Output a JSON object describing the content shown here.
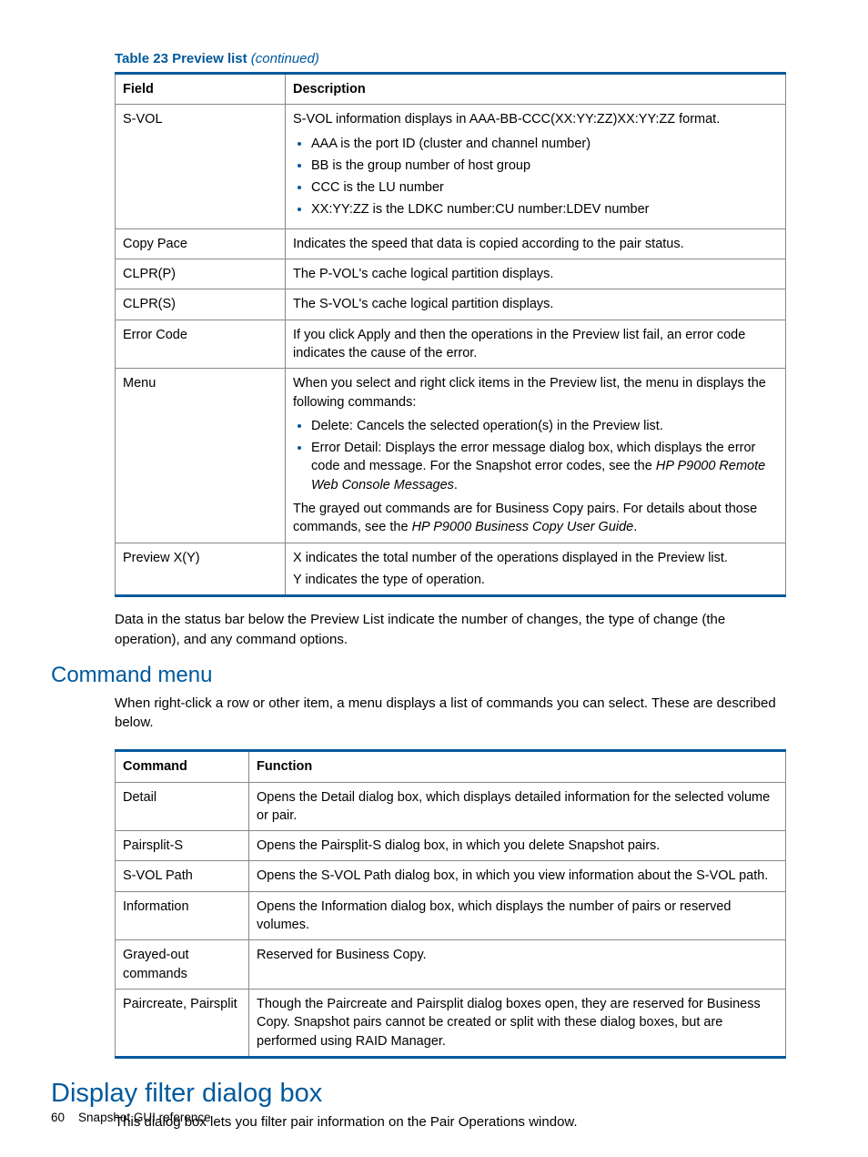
{
  "caption": {
    "label": "Table 23 Preview list",
    "cont": " (continued)"
  },
  "table23": {
    "head": {
      "field": "Field",
      "desc": "Description"
    },
    "rows": [
      {
        "field": "S-VOL",
        "intro": "S-VOL information displays in AAA-BB-CCC(XX:YY:ZZ)XX:YY:ZZ format.",
        "bullets": [
          "AAA is the port ID (cluster and channel number)",
          "BB is the group number of host group",
          "CCC is the LU number",
          "XX:YY:ZZ is the LDKC number:CU number:LDEV number"
        ]
      },
      {
        "field": "Copy Pace",
        "desc": "Indicates the speed that data is copied according to the pair status."
      },
      {
        "field": "CLPR(P)",
        "desc": "The P-VOL's cache logical partition displays."
      },
      {
        "field": "CLPR(S)",
        "desc": "The S-VOL's cache logical partition displays."
      },
      {
        "field": "Error Code",
        "desc": "If you click Apply and then the operations in the Preview list fail, an error code indicates the cause of the error."
      },
      {
        "field": "Menu",
        "intro": "When you select and right click items in the Preview list, the menu in displays the following commands:",
        "bullets": [
          "Delete: Cancels the selected operation(s) in the Preview list."
        ],
        "bullet2_pre": "Error Detail: Displays the error message dialog box, which displays the error code and message. For the Snapshot error codes, see the ",
        "bullet2_ital": "HP P9000 Remote Web Console Messages",
        "bullet2_post": ".",
        "outro_pre": "The grayed out commands are for Business Copy pairs. For details about those commands, see the ",
        "outro_ital": "HP P9000 Business Copy User Guide",
        "outro_post": "."
      },
      {
        "field": "Preview X(Y)",
        "line1": "X indicates the total number of the operations displayed in the Preview list.",
        "line2": "Y indicates the type of operation."
      }
    ]
  },
  "para_after_t23": "Data in the status bar below the Preview List indicate the number of changes, the type of change (the operation), and any command options.",
  "h2_cmd": "Command menu",
  "para_cmd": "When right-click a row or other item, a menu displays a list of commands you can select. These are described below.",
  "tablecmd": {
    "head": {
      "cmd": "Command",
      "func": "Function"
    },
    "rows": [
      {
        "cmd": "Detail",
        "func": "Opens the Detail dialog box, which displays detailed information for the selected volume or pair."
      },
      {
        "cmd": "Pairsplit-S",
        "func": "Opens the Pairsplit-S dialog box, in which you delete Snapshot pairs."
      },
      {
        "cmd": "S-VOL Path",
        "func": "Opens the S-VOL Path dialog box, in which you view information about the S-VOL path."
      },
      {
        "cmd": "Information",
        "func": "Opens the Information dialog box, which displays the number of pairs or reserved volumes."
      },
      {
        "cmd": "Grayed-out commands",
        "func": "Reserved for Business Copy."
      },
      {
        "cmd": "Paircreate, Pairsplit",
        "func": "Though the Paircreate and Pairsplit dialog boxes open, they are reserved for Business Copy. Snapshot pairs cannot be created or split with these dialog boxes, but are performed using RAID Manager."
      }
    ]
  },
  "h1_filter": "Display filter dialog box",
  "para_filter": "This dialog box lets you filter pair information on the Pair Operations window.",
  "footer": {
    "page": "60",
    "title": "Snapshot GUI reference"
  }
}
